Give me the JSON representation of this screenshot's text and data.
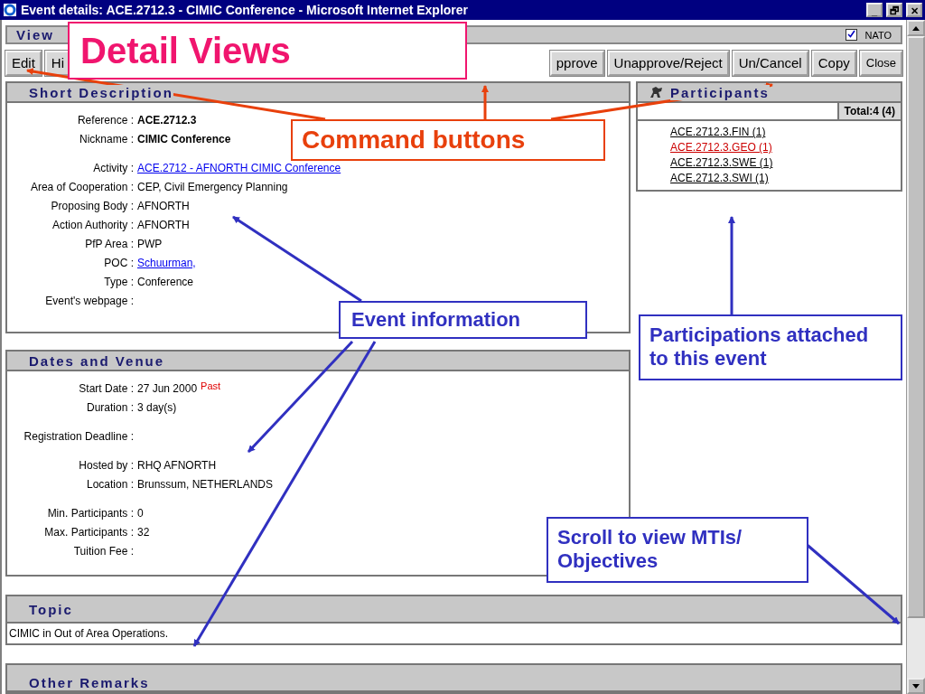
{
  "window": {
    "title": "Event details: ACE.2712.3 - CIMIC Conference - Microsoft Internet Explorer",
    "controls": [
      "_",
      "🗗",
      "✕"
    ]
  },
  "view_bar": {
    "label": "View",
    "nato": {
      "label": "NATO",
      "checked": true
    }
  },
  "buttons_left": [
    {
      "label": "Edit"
    },
    {
      "label": "Hi"
    }
  ],
  "buttons_right": [
    {
      "label": "pprove"
    },
    {
      "label": "Unapprove/Reject"
    },
    {
      "label": "Un/Cancel"
    },
    {
      "label": "Copy"
    },
    {
      "label": "Close"
    }
  ],
  "short_description": {
    "title": "Short Description",
    "groups": [
      [
        {
          "label": "Reference :",
          "value": "ACE.2712.3",
          "kind": "bold"
        },
        {
          "label": "Nickname :",
          "value": "CIMIC Conference",
          "kind": "bold"
        }
      ],
      [
        {
          "label": "Activity :",
          "value": "ACE.2712 - AFNORTH CIMIC Conference",
          "kind": "link"
        },
        {
          "label": "Area of Cooperation :",
          "value": "CEP, Civil Emergency Planning",
          "kind": "text"
        },
        {
          "label": "Proposing Body :",
          "value": "AFNORTH",
          "kind": "text"
        },
        {
          "label": "Action Authority :",
          "value": "AFNORTH",
          "kind": "text"
        },
        {
          "label": "PfP Area :",
          "value": "PWP",
          "kind": "text"
        },
        {
          "label": "POC :",
          "value": "Schuurman,",
          "kind": "link"
        },
        {
          "label": "Type :",
          "value": "Conference",
          "kind": "text"
        },
        {
          "label": "Event's webpage :"
        }
      ]
    ]
  },
  "participants": {
    "title": "Participants",
    "total": "Total:4 (4)",
    "items": [
      {
        "label": "ACE.2712.3.FIN (1)",
        "color": "#000000"
      },
      {
        "label": "ACE.2712.3.GEO (1)",
        "color": "#cc0000"
      },
      {
        "label": "ACE.2712.3.SWE (1)",
        "color": "#000000"
      },
      {
        "label": "ACE.2712.3.SWI (1)",
        "color": "#000000"
      }
    ]
  },
  "dates_and_venue": {
    "title": "Dates and Venue",
    "groups": [
      [
        {
          "label": "Start Date :",
          "value": "27 Jun 2000",
          "note": "Past",
          "kind": "text"
        },
        {
          "label": "Duration :",
          "value": "3 day(s)",
          "kind": "text"
        }
      ],
      [
        {
          "label": "Registration Deadline :"
        }
      ],
      [
        {
          "label": "Hosted by :",
          "value": "RHQ AFNORTH",
          "kind": "text"
        },
        {
          "label": "Location :",
          "value": "Brunssum, NETHERLANDS",
          "kind": "text"
        }
      ],
      [
        {
          "label": "Min. Participants :",
          "value": "0",
          "kind": "text"
        },
        {
          "label": "Max. Participants :",
          "value": "32",
          "kind": "text"
        },
        {
          "label": "Tuition Fee :"
        }
      ]
    ]
  },
  "topic": {
    "title": "Topic",
    "text": "CIMIC in Out of Area Operations."
  },
  "other_remarks": {
    "title": "Other Remarks"
  },
  "callouts": [
    {
      "text": "Detail Views",
      "kind": "magenta"
    },
    {
      "text": "Command buttons",
      "kind": "orange"
    },
    {
      "text": "Event information",
      "kind": "blue"
    },
    {
      "text": "Participations attached to this event",
      "kind": "blue"
    },
    {
      "text": "Scroll to view MTIs/ Objectives",
      "kind": "blue"
    }
  ]
}
